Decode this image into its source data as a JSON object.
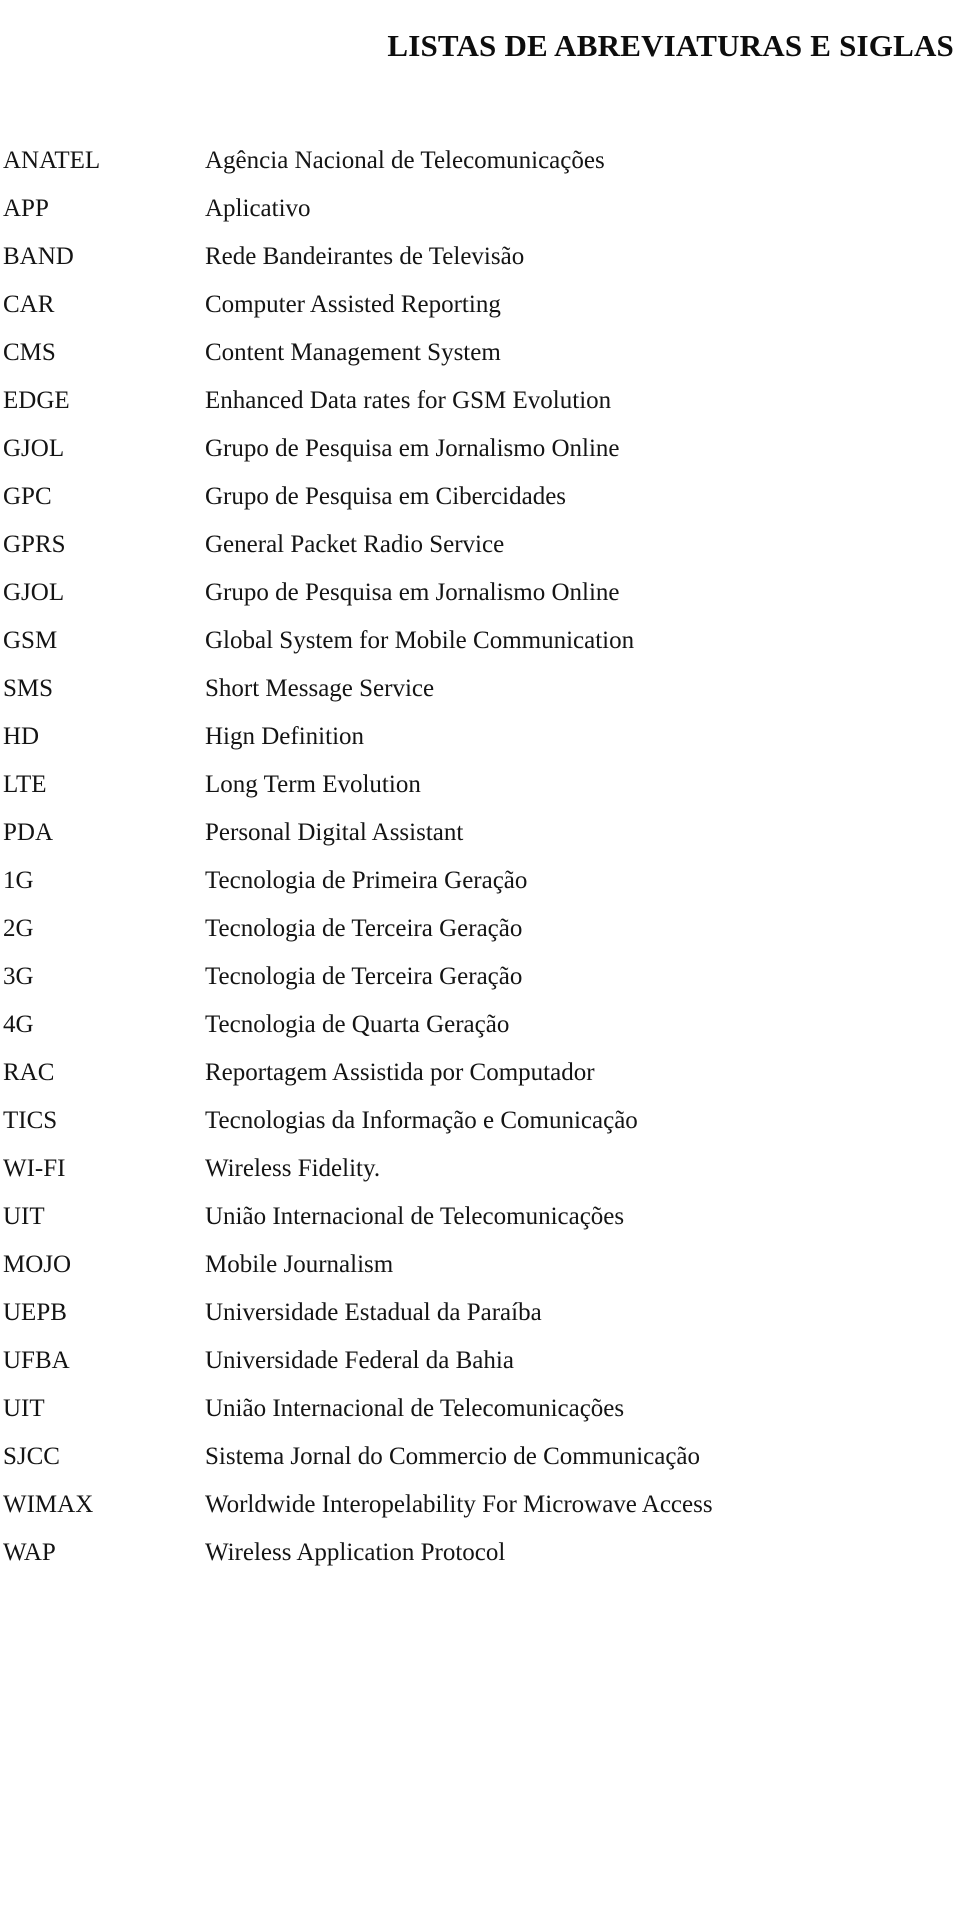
{
  "document": {
    "title": "LISTAS DE ABREVIATURAS E SIGLAS"
  },
  "abbreviations": [
    {
      "term": "ANATEL",
      "definition": "Agência Nacional de Telecomunicações"
    },
    {
      "term": "APP",
      "definition": "Aplicativo"
    },
    {
      "term": "BAND",
      "definition": "Rede Bandeirantes de Televisão"
    },
    {
      "term": "CAR",
      "definition": "Computer Assisted Reporting"
    },
    {
      "term": "CMS",
      "definition": "Content Management System"
    },
    {
      "term": "EDGE",
      "definition": "Enhanced Data rates for GSM Evolution"
    },
    {
      "term": "GJOL",
      "definition": "Grupo de Pesquisa em Jornalismo Online"
    },
    {
      "term": "GPC",
      "definition": "Grupo de Pesquisa em Cibercidades"
    },
    {
      "term": "GPRS",
      "definition": "General Packet Radio Service"
    },
    {
      "term": "GJOL",
      "definition": "Grupo de Pesquisa em Jornalismo Online"
    },
    {
      "term": "GSM",
      "definition": "Global System for Mobile Communication"
    },
    {
      "term": "SMS",
      "definition": "Short Message Service"
    },
    {
      "term": "HD",
      "definition": "Hign Definition"
    },
    {
      "term": "LTE",
      "definition": "Long Term Evolution"
    },
    {
      "term": "PDA",
      "definition": "Personal Digital Assistant"
    },
    {
      "term": "1G",
      "definition": "Tecnologia de Primeira Geração"
    },
    {
      "term": "2G",
      "definition": "Tecnologia de Terceira Geração"
    },
    {
      "term": "3G",
      "definition": "Tecnologia de Terceira Geração"
    },
    {
      "term": "4G",
      "definition": "Tecnologia de Quarta Geração"
    },
    {
      "term": "RAC",
      "definition": "Reportagem Assistida por Computador"
    },
    {
      "term": "TICS",
      "definition": "Tecnologias da Informação e Comunicação"
    },
    {
      "term": "WI-FI",
      "definition": "Wireless Fidelity."
    },
    {
      "term": "UIT",
      "definition": "União Internacional de Telecomunicações"
    },
    {
      "term": "MOJO",
      "definition": "Mobile Journalism"
    },
    {
      "term": "UEPB",
      "definition": "Universidade Estadual da Paraíba"
    },
    {
      "term": "UFBA",
      "definition": "Universidade Federal da Bahia"
    },
    {
      "term": "UIT",
      "definition": "União Internacional de Telecomunicações"
    },
    {
      "term": "SJCC",
      "definition": "Sistema Jornal do Commercio de Communicação"
    },
    {
      "term": "WIMAX",
      "definition": "Worldwide Interopelability For Microwave Access"
    },
    {
      "term": "WAP",
      "definition": "Wireless Application Protocol"
    }
  ]
}
